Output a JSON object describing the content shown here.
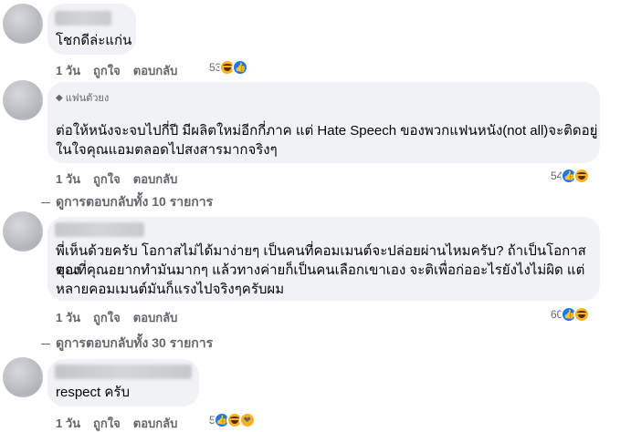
{
  "comments": [
    {
      "text": "โชกดีล่ะแก่น",
      "time": "1 วัน",
      "like": "ถูกใจ",
      "reply": "ตอบกลับ",
      "reaction_count": "53",
      "reactions": [
        "haha-icon",
        "like-icon"
      ]
    },
    {
      "badge": "แฟนตัวยง",
      "text_line1": "ต่อให้หนังจะจบไปกี่ปี มีผลิตใหม่อีกกี่ภาค แต่ Hate Speech ของพวกแฟนหนัง(not all)จะติดอยู่",
      "text_line2": "ในใจคุณแอมตลอดไปสงสารมากจริงๆ",
      "time": "1 วัน",
      "like": "ถูกใจ",
      "reply": "ตอบกลับ",
      "reaction_count": "54",
      "reactions": [
        "like-icon",
        "haha-icon"
      ],
      "view_replies": "ดูการตอบกลับทั้ง 10 รายการ"
    },
    {
      "text_line1": "พี่เห็นด้วยครับ โอกาสไม่ได้มาง่ายๆ เป็นคนที่คอมเมนต์จะปล่อยผ่านไหมครับ? ถ้าเป็นโอกาสของ",
      "text_line2": "คุณที่คุณอยากทำมันมากๆ แล้วทางค่ายก็เป็นคนเลือกเขาเอง จะติเพื่อก่ออะไรยังไงไม่ผิด แต่",
      "text_line3": "หลายคอมเมนต์มันก็แรงไปจริงๆครับผม",
      "time": "1 วัน",
      "like": "ถูกใจ",
      "reply": "ตอบกลับ",
      "reaction_count": "60",
      "reactions": [
        "like-icon",
        "haha-icon"
      ],
      "view_replies": "ดูการตอบกลับทั้ง 30 รายการ"
    },
    {
      "text": "respect ครับ",
      "time": "1 วัน",
      "like": "ถูกใจ",
      "reply": "ตอบกลับ",
      "reaction_count": "5",
      "reactions": [
        "like-icon",
        "haha-icon",
        "care-icon"
      ]
    }
  ],
  "colors": {
    "bubble": "#f0f2f5",
    "meta_text": "#65676b",
    "like_blue": "#1877f2",
    "haha_yellow": "#f7b125"
  }
}
